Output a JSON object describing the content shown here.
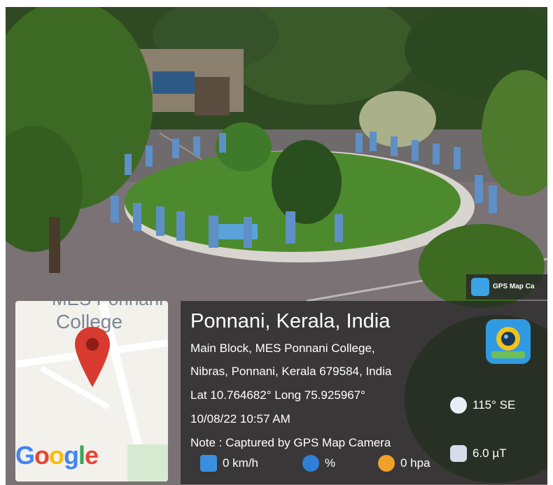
{
  "map": {
    "college_label": "College",
    "college_top_label": "MES Ponnani",
    "provider_logo": "Google"
  },
  "badge": {
    "app_name": "GPS Map Ca"
  },
  "location": {
    "title": "Ponnani, Kerala, India",
    "address_line1": "Main Block, MES Ponnani College,",
    "address_line2": "Nibras, Ponnani, Kerala 679584, India",
    "coordinates": "Lat 10.764682° Long 75.925967°",
    "datetime": "10/08/22 10:57 AM",
    "note": "Note : Captured by GPS Map Camera"
  },
  "sensors": {
    "compass": "115° SE",
    "magnetic": "6.0 µT",
    "wind": "0 km/h",
    "humidity": "%",
    "pressure": "0 hpa"
  },
  "icons": [
    "map-pin-icon",
    "gps-map-camera-icon",
    "compass-icon",
    "magnetic-field-icon",
    "wind-icon",
    "humidity-icon",
    "pressure-gauge-icon"
  ],
  "colors": {
    "pin_red": "#d93a2f",
    "panel_bg": "#262626",
    "icon_blue": "#2f9ae2",
    "google_blue": "#4285F4",
    "google_red": "#EA4335",
    "google_yellow": "#FBBC05",
    "google_green": "#34A853"
  }
}
